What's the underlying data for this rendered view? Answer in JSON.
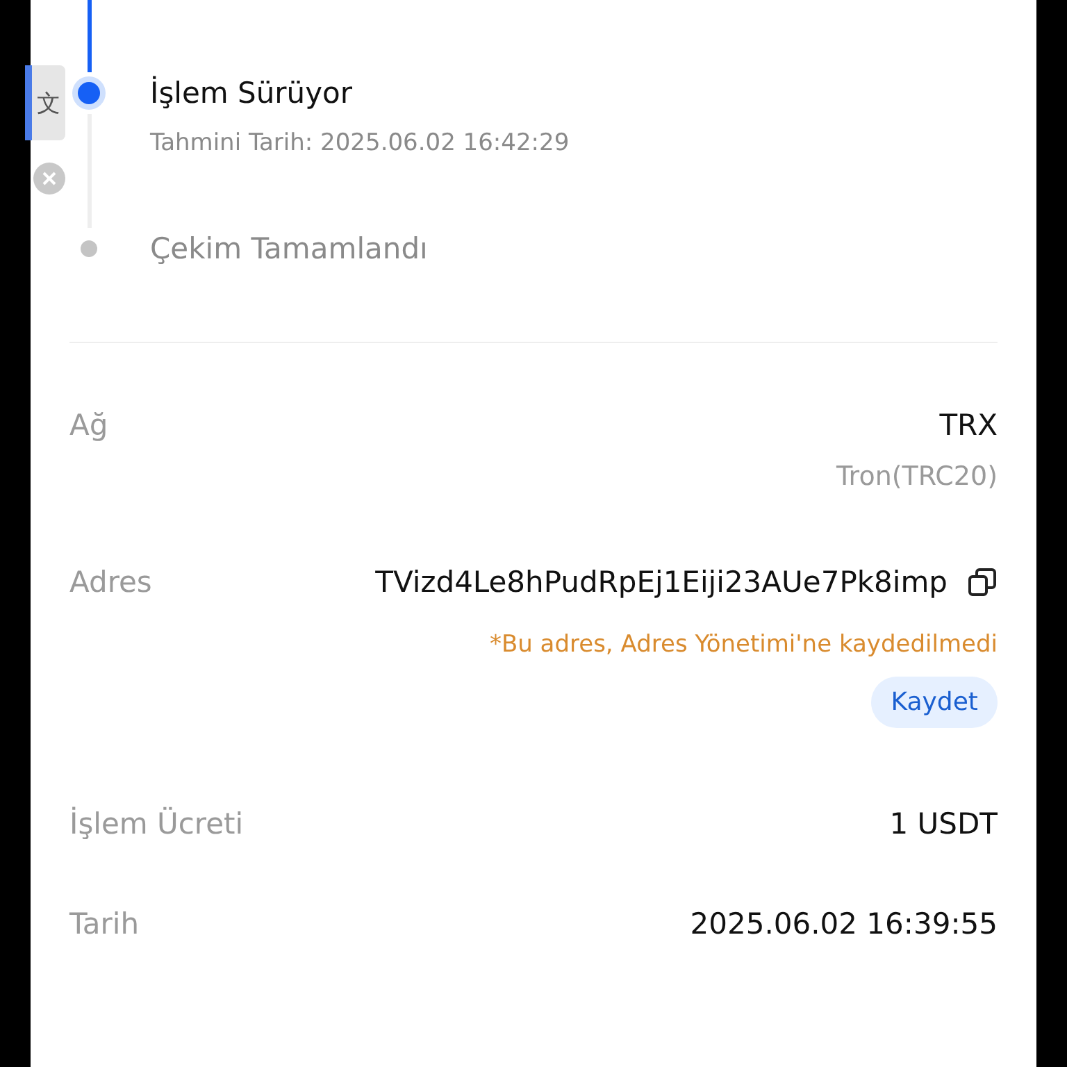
{
  "translate_widget": {
    "glyph": "文"
  },
  "steps": [
    {
      "title": "İşlem Sürüyor",
      "subtitle": "Tahmini Tarih: 2025.06.02 16:42:29",
      "current": true
    },
    {
      "title": "Çekim Tamamlandı",
      "current": false
    }
  ],
  "details": [
    {
      "label": "Ağ",
      "value": "TRX",
      "secondary": "Tron(TRC20)"
    },
    {
      "label": "Adres",
      "value": "TVizd4Le8hPudRpEj1Eiji23AUe7Pk8imp",
      "copyable": true,
      "warning": "*Bu adres, Adres Yönetimi'ne kaydedilmedi",
      "action": "Kaydet"
    },
    {
      "label": "İşlem Ücreti",
      "value": "1 USDT"
    },
    {
      "label": "Tarih",
      "value": "2025.06.02 16:39:55"
    }
  ]
}
